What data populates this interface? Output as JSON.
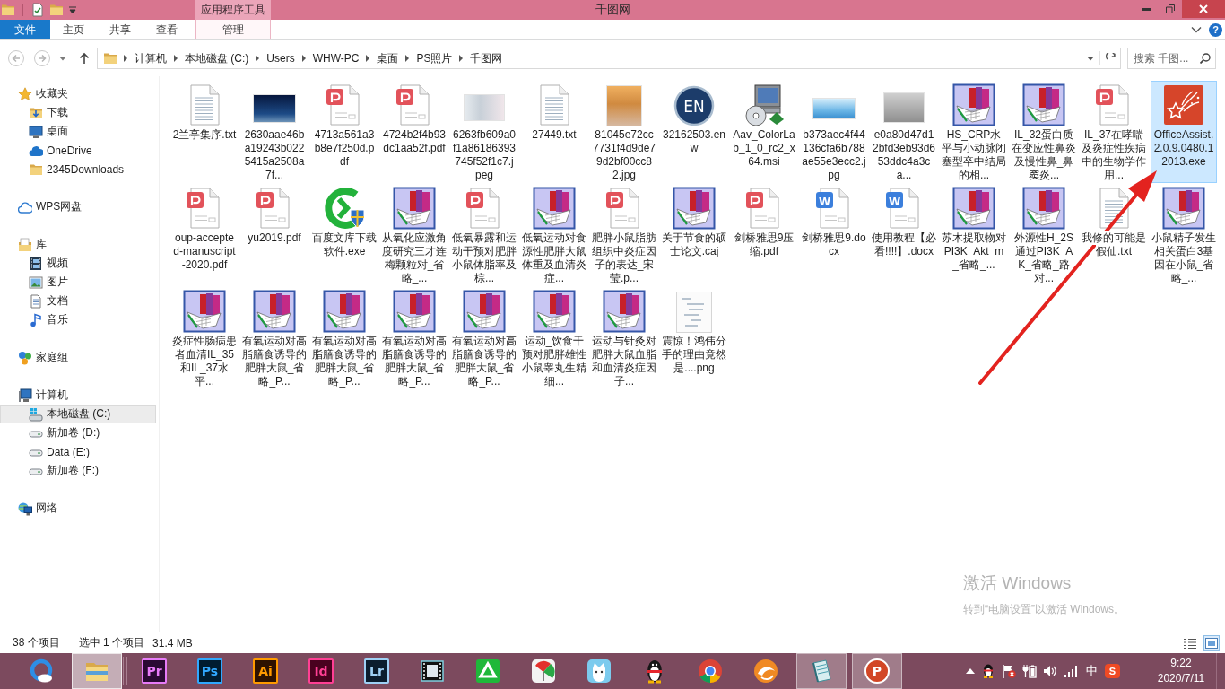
{
  "window": {
    "title": "千图网",
    "context_group": "应用程序工具"
  },
  "ribbon": {
    "file_tab": "文件",
    "tabs": [
      {
        "label": "主页",
        "selected": false,
        "contextual": false
      },
      {
        "label": "共享",
        "selected": false,
        "contextual": false
      },
      {
        "label": "查看",
        "selected": false,
        "contextual": false
      },
      {
        "label": "管理",
        "selected": false,
        "contextual": true
      }
    ],
    "help_label": "?"
  },
  "navigation_buttons": {
    "back": {
      "disabled": true
    },
    "forward": {
      "disabled": true
    }
  },
  "address_bar": {
    "path": [
      "计算机",
      "本地磁盘 (C:)",
      "Users",
      "WHW-PC",
      "桌面",
      "PS照片",
      "千图网"
    ]
  },
  "search": {
    "placeholder": "搜索 千图..."
  },
  "sidebar": {
    "items": [
      {
        "label": "收藏夹",
        "selected": false,
        "children": [
          {
            "label": "下载",
            "selected": false
          },
          {
            "label": "桌面",
            "selected": false
          },
          {
            "label": "OneDrive",
            "selected": false
          },
          {
            "label": "2345Downloads",
            "selected": false
          }
        ]
      },
      {
        "label": "WPS网盘",
        "selected": false
      },
      {
        "label": "库",
        "selected": false,
        "children": [
          {
            "label": "视频",
            "selected": false
          },
          {
            "label": "图片",
            "selected": false
          },
          {
            "label": "文档",
            "selected": false
          },
          {
            "label": "音乐",
            "selected": false
          }
        ]
      },
      {
        "label": "家庭组",
        "selected": false
      },
      {
        "label": "计算机",
        "selected": false,
        "children": [
          {
            "label": "本地磁盘 (C:)",
            "selected": true
          },
          {
            "label": "新加卷 (D:)",
            "selected": false
          },
          {
            "label": "Data (E:)",
            "selected": false
          },
          {
            "label": "新加卷 (F:)",
            "selected": false
          }
        ]
      },
      {
        "label": "网络",
        "selected": false
      }
    ]
  },
  "files": [
    {
      "name": "2兰亭集序.txt",
      "kind": "txt",
      "selected": false
    },
    {
      "name": "2630aae46ba19243b0225415a2508a7f...",
      "kind": "image",
      "selected": false
    },
    {
      "name": "4713a561a3b8e7f250d.pdf",
      "kind": "pdf",
      "selected": false
    },
    {
      "name": "4724b2f4b93dc1aa52f.pdf",
      "kind": "pdf",
      "selected": false
    },
    {
      "name": "6263fb609a0f1a86186393745f52f1c7.jpeg",
      "kind": "image",
      "selected": false
    },
    {
      "name": "27449.txt",
      "kind": "txt",
      "selected": false
    },
    {
      "name": "81045e72cc7731f4d9de79d2bf00cc82.jpg",
      "kind": "image",
      "selected": false
    },
    {
      "name": "32162503.enw",
      "kind": "enw",
      "badge": "EN",
      "selected": false
    },
    {
      "name": "Aav_ColorLab_1_0_rc2_x64.msi",
      "kind": "msi",
      "selected": false
    },
    {
      "name": "b373aec4f44136cfa6b788ae55e3ecc2.jpg",
      "kind": "image",
      "selected": false
    },
    {
      "name": "e0a80d47d12bfd3eb93d653ddc4a3ca...",
      "kind": "image",
      "selected": false
    },
    {
      "name": "HS_CRP水平与小动脉闭塞型卒中结局的相...",
      "kind": "caj",
      "selected": false
    },
    {
      "name": "IL_32蛋白质在变应性鼻炎及慢性鼻_鼻窦炎...",
      "kind": "caj",
      "selected": false
    },
    {
      "name": "IL_37在哮喘及炎症性疾病中的生物学作用...",
      "kind": "pdf",
      "selected": false
    },
    {
      "name": "OfficeAssist.2.0.9.0480.12013.exe",
      "kind": "exe",
      "selected": true
    },
    {
      "name": "oup-accepted-manuscript-2020.pdf",
      "kind": "pdf",
      "selected": false
    },
    {
      "name": "yu2019.pdf",
      "kind": "pdf",
      "selected": false
    },
    {
      "name": "百度文库下载软件.exe",
      "kind": "exe",
      "selected": false
    },
    {
      "name": "从氧化应激角度研究三才连梅颗粒对_省略_...",
      "kind": "caj",
      "selected": false
    },
    {
      "name": "低氧暴露和运动干预对肥胖小鼠体脂率及棕...",
      "kind": "pdf",
      "selected": false
    },
    {
      "name": "低氧运动对食源性肥胖大鼠体重及血清炎症...",
      "kind": "caj",
      "selected": false
    },
    {
      "name": "肥胖小鼠脂肪组织中炎症因子的表达_宋莹.p...",
      "kind": "pdf",
      "selected": false
    },
    {
      "name": "关于节食的硕士论文.caj",
      "kind": "caj",
      "selected": false
    },
    {
      "name": "剑桥雅思9压缩.pdf",
      "kind": "pdf",
      "selected": false
    },
    {
      "name": "剑桥雅思9.docx",
      "kind": "docx",
      "badge": "W",
      "selected": false
    },
    {
      "name": "使用教程【必看!!!!】.docx",
      "kind": "docx",
      "badge": "W",
      "selected": false
    },
    {
      "name": "苏木提取物对PI3K_Akt_m_省略_...",
      "kind": "caj",
      "selected": false
    },
    {
      "name": "外源性H_2S通过PI3K_AK_省略_路对...",
      "kind": "caj",
      "selected": false
    },
    {
      "name": "我修的可能是假仙.txt",
      "kind": "txt",
      "selected": false
    },
    {
      "name": "小鼠精子发生相关蛋白3基因在小鼠_省略_...",
      "kind": "caj",
      "selected": false
    },
    {
      "name": "炎症性肠病患者血清IL_35和IL_37水平...",
      "kind": "caj",
      "selected": false
    },
    {
      "name": "有氧运动对高脂膳食诱导的肥胖大鼠_省略_P...",
      "kind": "caj",
      "selected": false
    },
    {
      "name": "有氧运动对高脂膳食诱导的肥胖大鼠_省略_P...",
      "kind": "caj",
      "selected": false
    },
    {
      "name": "有氧运动对高脂膳食诱导的肥胖大鼠_省略_P...",
      "kind": "caj",
      "selected": false
    },
    {
      "name": "有氧运动对高脂膳食诱导的肥胖大鼠_省略_P...",
      "kind": "caj",
      "selected": false
    },
    {
      "name": "运动_饮食干预对肥胖雄性小鼠睾丸生精细...",
      "kind": "caj",
      "selected": false
    },
    {
      "name": "运动与针灸对肥胖大鼠血脂和血清炎症因子...",
      "kind": "caj",
      "selected": false
    },
    {
      "name": "震惊！鸿伟分手的理由竟然是....png",
      "kind": "image",
      "selected": false
    }
  ],
  "status_bar": {
    "count": "38 个项目",
    "selection": "选中 1 个项目",
    "size": "31.4 MB",
    "views": [
      {
        "selected": false
      },
      {
        "selected": true
      }
    ]
  },
  "activation_notice": {
    "title": "激活 Windows",
    "text": "转到“电脑设置”以激活 Windows。"
  },
  "taskbar": {
    "apps": [
      {
        "running": false,
        "selected": false
      },
      {
        "running": true,
        "selected": true
      },
      {
        "label": "Pr",
        "running": false,
        "selected": false
      },
      {
        "label": "Ps",
        "running": false,
        "selected": false
      },
      {
        "label": "Ai",
        "running": false,
        "selected": false
      },
      {
        "label": "Id",
        "running": false,
        "selected": false
      },
      {
        "label": "Lr",
        "running": false,
        "selected": false
      },
      {
        "running": false,
        "selected": false
      },
      {
        "running": false,
        "selected": false
      },
      {
        "running": false,
        "selected": false
      },
      {
        "running": false,
        "selected": false
      },
      {
        "running": false,
        "selected": false
      },
      {
        "running": false,
        "selected": false
      },
      {
        "running": false,
        "selected": false
      },
      {
        "running": true,
        "selected": false
      },
      {
        "label": "P",
        "running": true,
        "selected": false
      }
    ],
    "tray": {
      "input_mode": "中",
      "input_badge": "S",
      "time": "9:22",
      "date": "2020/7/11"
    }
  }
}
